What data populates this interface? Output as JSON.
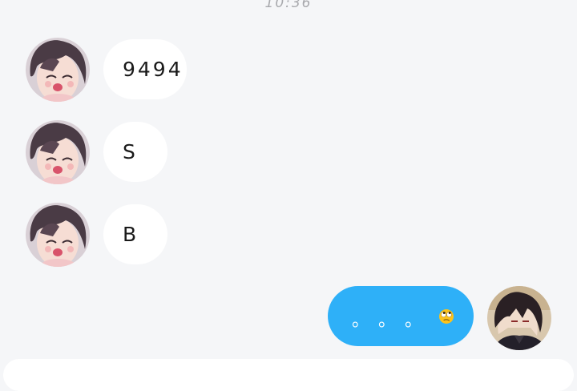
{
  "header": {
    "time": "10:36"
  },
  "messages": [
    {
      "sender": "contact",
      "text": "9494"
    },
    {
      "sender": "contact",
      "text": "S"
    },
    {
      "sender": "contact",
      "text": "B"
    },
    {
      "sender": "me",
      "text": "。。。",
      "emoji": "rolling-eyes"
    }
  ],
  "colors": {
    "background": "#f5f6f8",
    "incoming_bubble": "#ffffff",
    "outgoing_bubble": "#2eb0f8"
  },
  "icons": [
    "contact-avatar",
    "self-avatar",
    "rolling-eyes-emoji"
  ]
}
